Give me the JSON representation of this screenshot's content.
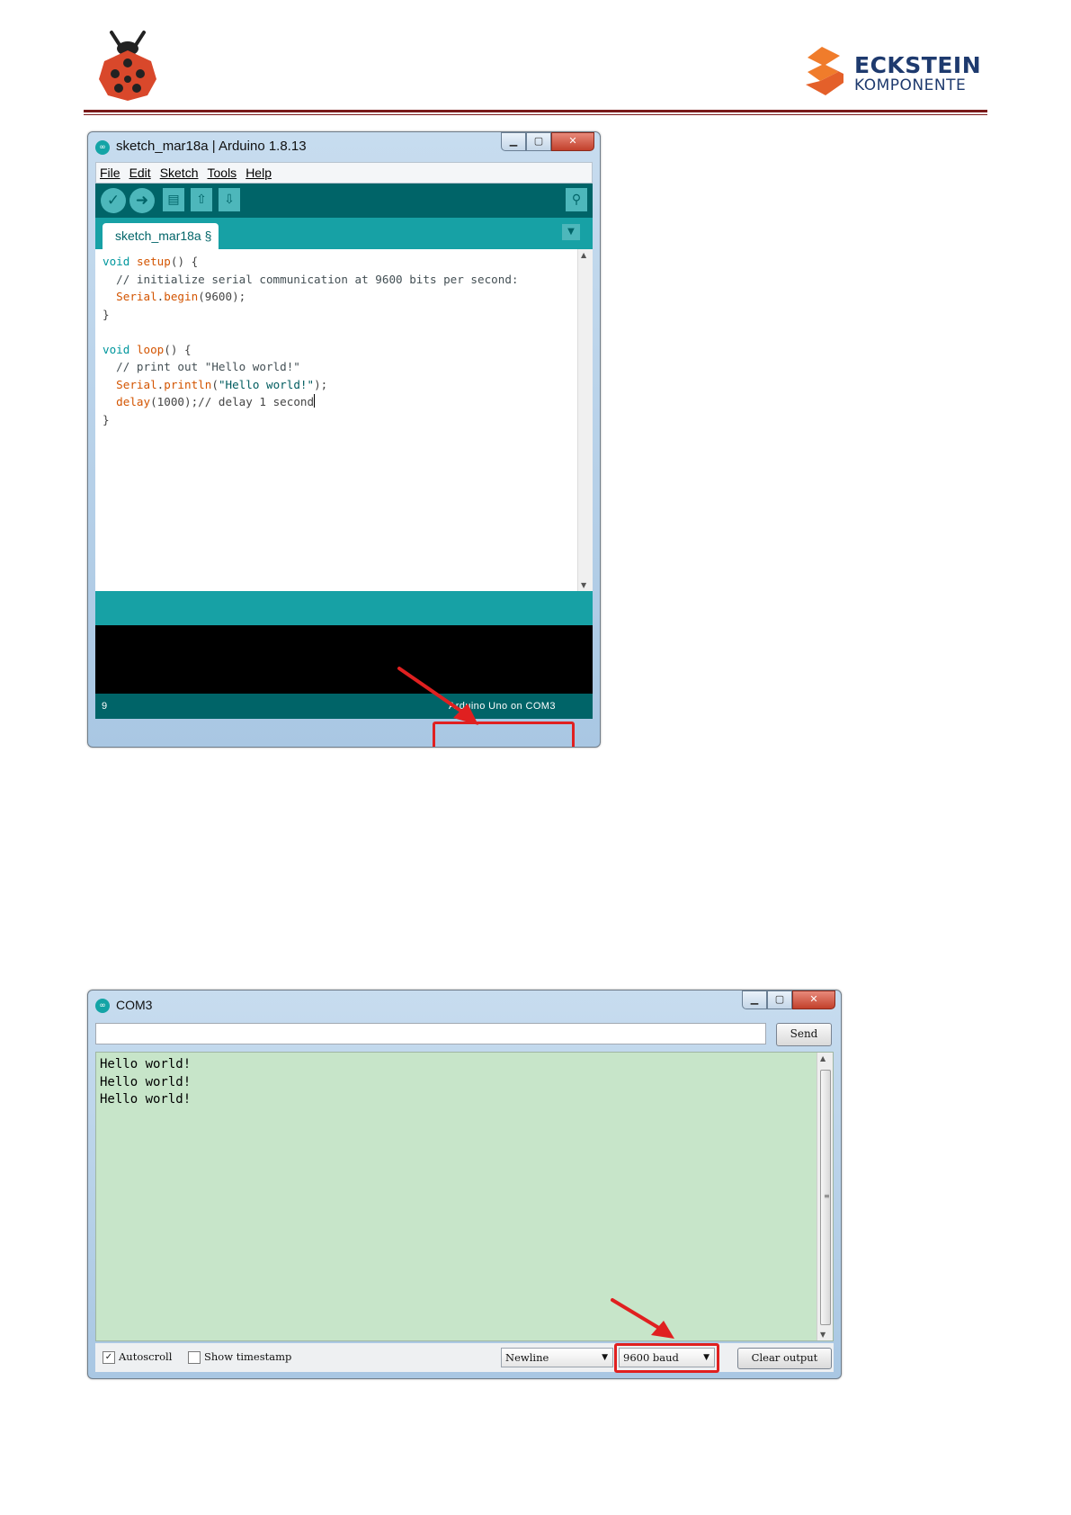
{
  "header": {
    "brand_top": "ECKSTEIN",
    "brand_bottom": "KOMPONENTE"
  },
  "ide": {
    "window_title": "sketch_mar18a | Arduino 1.8.13",
    "menu": [
      "File",
      "Edit",
      "Sketch",
      "Tools",
      "Help"
    ],
    "tab_label": "sketch_mar18a §",
    "code": {
      "l1_kw": "void",
      "l1_fn": "setup",
      "l1_rest": "() {",
      "l2": "  // initialize serial communication at 9600 bits per second:",
      "l3_fn": "Serial",
      "l3_dot": ".",
      "l3_fn2": "begin",
      "l3_rest": "(9600);",
      "l4": "}",
      "l6_kw": "void",
      "l6_fn": "loop",
      "l6_rest": "() {",
      "l7": "  // print out \"Hello world!\"",
      "l8_fn": "Serial",
      "l8_dot": ".",
      "l8_fn2": "println",
      "l8_p": "(",
      "l8_str": "\"Hello world!\"",
      "l8_rest": ");",
      "l9_fn": "delay",
      "l9_rest": "(1000);// delay 1 second",
      "l10": "}"
    },
    "status_line": "9",
    "board_port": "Arduino Uno on COM3"
  },
  "serial_monitor": {
    "window_title": "COM3",
    "input_value": "",
    "send_label": "Send",
    "output_lines": "Hello world!\nHello world!\nHello world!",
    "autoscroll_label": "Autoscroll",
    "autoscroll_checked": true,
    "timestamp_label": "Show timestamp",
    "timestamp_checked": false,
    "line_ending": "Newline",
    "baud_rate": "9600 baud",
    "clear_label": "Clear output"
  },
  "colors": {
    "arduino_dark_teal": "#006468",
    "arduino_teal": "#17a1a5",
    "serial_output_bg": "#c7e5c9",
    "highlight_red": "#e02020"
  }
}
